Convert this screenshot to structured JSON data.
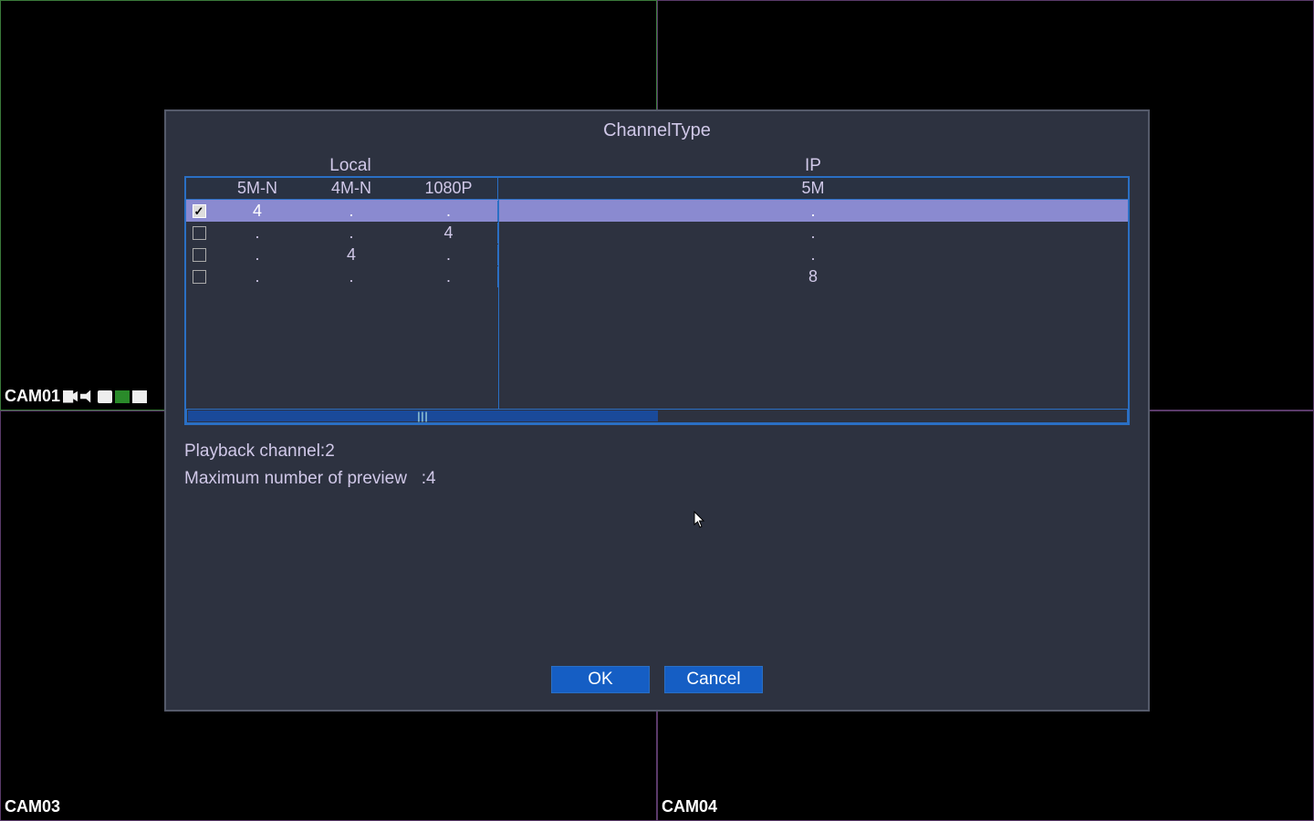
{
  "cams": {
    "tl": "CAM01",
    "tr": "",
    "bl": "CAM03",
    "br": "CAM04"
  },
  "dialog": {
    "title": "ChannelType",
    "groups": {
      "local": "Local",
      "ip": "IP"
    },
    "cols": {
      "c1": "5M-N",
      "c2": "4M-N",
      "c3": "1080P",
      "c4": "5M"
    },
    "rows": [
      {
        "checked": true,
        "selected": true,
        "v1": "4",
        "v2": ".",
        "v3": ".",
        "v4": "."
      },
      {
        "checked": false,
        "selected": false,
        "v1": ".",
        "v2": ".",
        "v3": "4",
        "v4": "."
      },
      {
        "checked": false,
        "selected": false,
        "v1": ".",
        "v2": "4",
        "v3": ".",
        "v4": "."
      },
      {
        "checked": false,
        "selected": false,
        "v1": ".",
        "v2": ".",
        "v3": ".",
        "v4": "8"
      }
    ],
    "playback_label": "Playback channel: ",
    "playback_value": "2",
    "preview_label": "Maximum number of preview   : ",
    "preview_value": "4",
    "ok": "OK",
    "cancel": "Cancel"
  }
}
